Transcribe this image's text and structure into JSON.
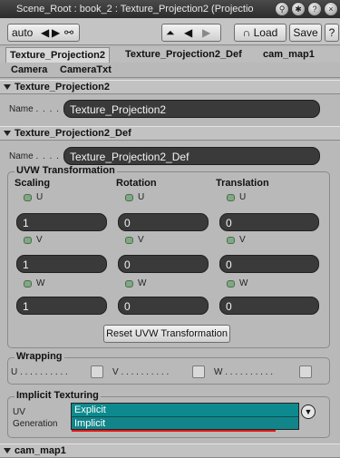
{
  "window": {
    "title": "Scene_Root : book_2 : Texture_Projection2 (Projectio",
    "icons": [
      "lock-icon",
      "gear-icon",
      "help-icon",
      "close-icon"
    ]
  },
  "toolbar": {
    "auto_label": "auto",
    "load_label": "Load",
    "save_label": "Save",
    "question_label": "?"
  },
  "tabs": [
    "Texture_Projection2",
    "Texture_Projection2_Def",
    "cam_map1"
  ],
  "subtabs": [
    "Camera",
    "CameraTxt"
  ],
  "sections": {
    "projection": {
      "header": "Texture_Projection2",
      "name_label": "Name",
      "name_value": "Texture_Projection2"
    },
    "projection_def": {
      "header": "Texture_Projection2_Def",
      "name_label": "Name",
      "name_value": "Texture_Projection2_Def",
      "uvw": {
        "title": "UVW Transformation",
        "columns": [
          "Scaling",
          "Rotation",
          "Translation"
        ],
        "axes": [
          "U",
          "V",
          "W"
        ],
        "scaling": [
          "1",
          "1",
          "1"
        ],
        "rotation": [
          "0",
          "0",
          "0"
        ],
        "translation": [
          "0",
          "0",
          "0"
        ],
        "reset_label": "Reset UVW Transformation"
      },
      "wrapping": {
        "title": "Wrapping",
        "axes": [
          "U",
          "V",
          "W"
        ]
      },
      "implicit": {
        "title": "Implicit Texturing",
        "uv_label": "UV",
        "generation_label": "Generation",
        "options": [
          "Explicit",
          "Implicit"
        ]
      }
    },
    "cam_map": {
      "header": "cam_map1"
    }
  },
  "colors": {
    "field_bg": "#3a3a3a",
    "dropdown_bg": "#0d8a8e",
    "highlight_red": "#e01818"
  }
}
